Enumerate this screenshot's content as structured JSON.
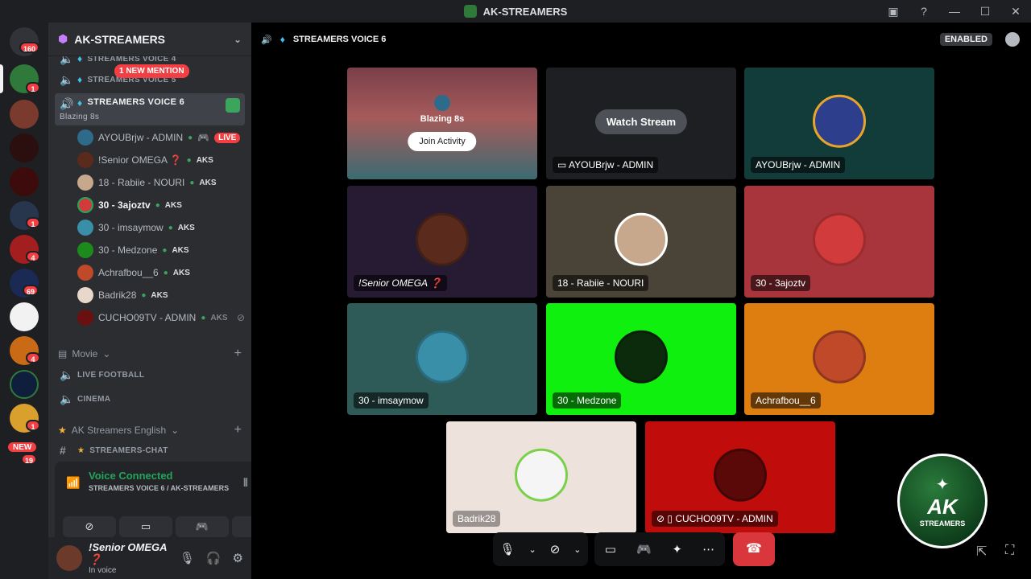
{
  "window": {
    "title": "AK-STREAMERS"
  },
  "rail": {
    "home_badge": "160",
    "badges": [
      "1",
      "1",
      "4",
      "69",
      "4",
      "1",
      "19"
    ],
    "new_label": "NEW"
  },
  "server": {
    "name": "AK-STREAMERS",
    "channels": {
      "top1": "STREAMERS VOICE 4",
      "top2": "STREAMERS VOICE 5",
      "mention": "1 NEW MENTION",
      "active": "STREAMERS VOICE 6",
      "active_activity": "Blazing 8s"
    },
    "members": [
      {
        "name": "AYOUBrjw - ADMIN",
        "live": "LIVE",
        "color": "#2e6b8a"
      },
      {
        "name": "!Senior OMEGA ❓",
        "tag": "AKS",
        "color": "#5a2b1c"
      },
      {
        "name": "18 - Rabiie - NOURI",
        "tag": "AKS",
        "color": "#c7a88c"
      },
      {
        "name": "30 - 3ajoztv",
        "tag": "AKS",
        "color": "#d13b3b"
      },
      {
        "name": "30 - imsaymow",
        "tag": "AKS",
        "color": "#3a8fa8"
      },
      {
        "name": "30 - Medzone",
        "tag": "AKS",
        "color": "#1c8a1c"
      },
      {
        "name": "Achrafbou__6",
        "tag": "AKS",
        "color": "#c0492a"
      },
      {
        "name": "Badrik28",
        "tag": "AKS",
        "color": "#e8d8cc"
      },
      {
        "name": "CUCHO09TV - ADMIN",
        "tag": "AKS",
        "color": "#6b1010"
      }
    ],
    "categories": {
      "movie": "Movie",
      "live_football": "LIVE FOOTBALL",
      "cinema": "CINEMA",
      "english": "AK Streamers English",
      "streamers_chat": "STREAMERS-CHAT"
    }
  },
  "voice": {
    "status": "Voice Connected",
    "channel": "STREAMERS VOICE 6 / AK-STREAMERS"
  },
  "user": {
    "name": "!Senior OMEGA ❓",
    "status": "In voice"
  },
  "stage": {
    "channel": "STREAMERS VOICE 6",
    "enabled": "ENABLED",
    "activity": {
      "name": "Blazing 8s",
      "join": "Join Activity"
    },
    "watch_stream": "Watch Stream",
    "tiles": [
      {
        "label": "AYOUBrjw - ADMIN",
        "bg": "#1e1f22"
      },
      {
        "label": "AYOUBrjw - ADMIN",
        "bg": "#123c3a"
      },
      {
        "label": "!Senior OMEGA ❓",
        "bg": "#271a33"
      },
      {
        "label": "18 - Rabiie - NOURI",
        "bg": "#4a4338"
      },
      {
        "label": "30 - 3ajoztv",
        "bg": "#a8343c"
      },
      {
        "label": "30 - imsaymow",
        "bg": "#2e5a58"
      },
      {
        "label": "30 - Medzone",
        "bg": "#0ff00e"
      },
      {
        "label": "Achrafbou__6",
        "bg": "#de7e10"
      },
      {
        "label": "Badrik28",
        "bg": "#eee2dc"
      },
      {
        "label": "CUCHO09TV - ADMIN",
        "bg": "#c10c0c"
      }
    ]
  },
  "branding": {
    "ak": "AK",
    "streamers": "STREAMERS"
  }
}
